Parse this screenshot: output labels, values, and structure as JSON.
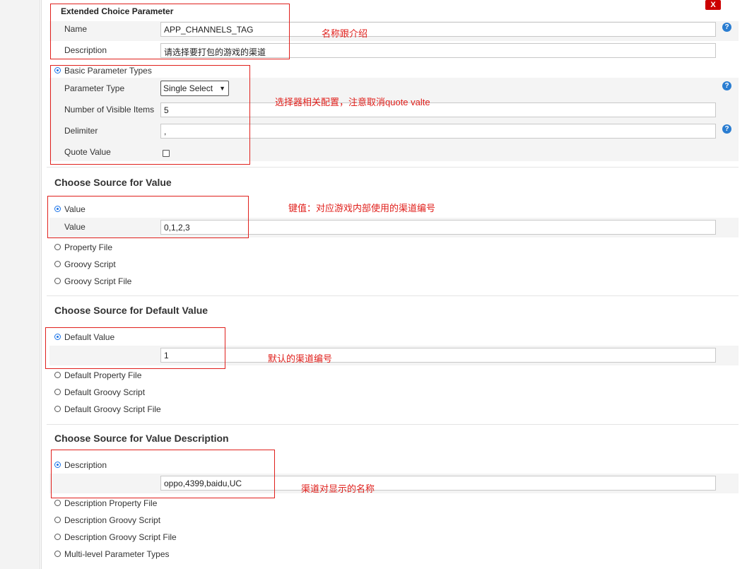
{
  "parameter": {
    "header": "Extended Choice Parameter",
    "close_label": "X",
    "name_label": "Name",
    "name_value": "APP_CHANNELS_TAG",
    "description_label": "Description",
    "description_value": "请选择要打包的游戏的渠道"
  },
  "basic": {
    "radio_label": "Basic Parameter Types",
    "type_label": "Parameter Type",
    "type_value": "Single Select",
    "visible_label": "Number of Visible Items",
    "visible_value": "5",
    "delimiter_label": "Delimiter",
    "delimiter_value": ",",
    "quote_label": "Quote Value"
  },
  "source_value": {
    "title": "Choose Source for Value",
    "options": [
      "Value",
      "Property File",
      "Groovy Script",
      "Groovy Script File"
    ],
    "field_label": "Value",
    "field_value": "0,1,2,3"
  },
  "source_default": {
    "title": "Choose Source for Default Value",
    "options": [
      "Default Value",
      "Default Property File",
      "Default Groovy Script",
      "Default Groovy Script File"
    ],
    "field_value": "1"
  },
  "source_desc": {
    "title": "Choose Source for Value Description",
    "options": [
      "Description",
      "Description Property File",
      "Description Groovy Script",
      "Description Groovy Script File"
    ],
    "field_value": "oppo,4399,baidu,UC"
  },
  "multi_level_label": "Multi-level Parameter Types",
  "help_label": "?",
  "annotations": {
    "name_note": "名称跟介绍",
    "selector_note": "选择器相关配置，注意取消quote valte",
    "value_note": "键值：对应游戏内部使用的渠道编号",
    "default_note": "默认的渠道编号",
    "desc_note": "渠道对显示的名称"
  },
  "colors": {
    "accent": "#1a73e8",
    "annotation": "#e0201c",
    "close": "#cc0000",
    "help": "#2a7dd1"
  }
}
